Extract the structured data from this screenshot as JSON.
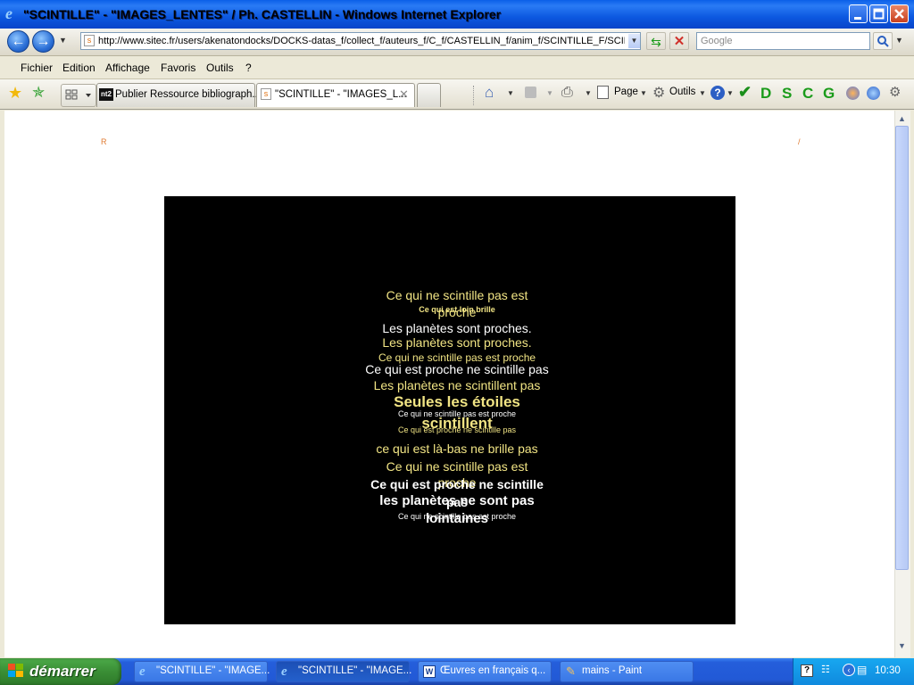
{
  "window": {
    "title": "\"SCINTILLE\" - \"IMAGES_LENTES\" / Ph. CASTELLIN - Windows Internet Explorer"
  },
  "address": {
    "url": "http://www.sitec.fr/users/akenatondocks/DOCKS-datas_f/collect_f/auteurs_f/C_f/CASTELLIN_f/anim_f/SCINTILLE_F/SCIN"
  },
  "search": {
    "placeholder": "Google"
  },
  "menu": [
    "Fichier",
    "Edition",
    "Affichage",
    "Favoris",
    "Outils",
    "?"
  ],
  "tabs": [
    {
      "label": "Publier Ressource bibliograph...",
      "icon": "nt2-icon"
    },
    {
      "label": "\"SCINTILLE\" - \"IMAGES_L...",
      "icon": "page-icon"
    }
  ],
  "commandbar": {
    "page_label": "Page",
    "tools_label": "Outils",
    "letter_icons": [
      "D",
      "S",
      "C",
      "G"
    ]
  },
  "page": {
    "left_mark": "R",
    "right_mark": "/"
  },
  "poem": [
    {
      "text": "Ce qui ne scintille pas est",
      "cls": "y",
      "size": 14,
      "weight": "normal"
    },
    {
      "text": "Ce qui est loin brille",
      "cls": "y",
      "size": 9,
      "weight": "bold"
    },
    {
      "text": "proche",
      "cls": "y",
      "size": 14,
      "weight": "normal"
    },
    {
      "text": "Les planètes sont proches.",
      "cls": "w",
      "size": 14,
      "weight": "normal"
    },
    {
      "text": "Les planètes sont proches.",
      "cls": "y",
      "size": 14,
      "weight": "normal"
    },
    {
      "text": "Ce qui ne scintille pas est proche",
      "cls": "y",
      "size": 12,
      "weight": "normal"
    },
    {
      "text": "Ce qui est proche ne scintille pas",
      "cls": "w",
      "size": 14,
      "weight": "normal"
    },
    {
      "text": "Les planètes ne scintillent pas",
      "cls": "y",
      "size": 14,
      "weight": "normal"
    },
    {
      "text": "Seules les étoiles",
      "cls": "y",
      "size": 17,
      "weight": "bold"
    },
    {
      "text": "Ce qui ne scintille pas est proche",
      "cls": "w",
      "size": 9,
      "weight": "normal"
    },
    {
      "text": "scintillent",
      "cls": "y",
      "size": 17,
      "weight": "bold"
    },
    {
      "text": "Ce qui est proche ne scintille pas",
      "cls": "y",
      "size": 9,
      "weight": "normal"
    },
    {
      "text": "ce qui est là-bas ne brille pas",
      "cls": "y",
      "size": 14,
      "weight": "normal"
    },
    {
      "text": "Ce qui ne scintille pas est",
      "cls": "y",
      "size": 14,
      "weight": "normal"
    },
    {
      "text": "proche",
      "cls": "y",
      "size": 14,
      "weight": "normal"
    },
    {
      "text": "Ce qui est proche ne scintille",
      "cls": "w",
      "size": 14,
      "weight": "bold"
    },
    {
      "text": "les planètes ne sont pas",
      "cls": "w",
      "size": 15,
      "weight": "bold"
    },
    {
      "text": "pas",
      "cls": "w",
      "size": 14,
      "weight": "bold"
    },
    {
      "text": "Ce qui ne scintille pas est proche",
      "cls": "w",
      "size": 9,
      "weight": "normal"
    },
    {
      "text": "lointaines",
      "cls": "w",
      "size": 15,
      "weight": "bold"
    }
  ],
  "taskbar": {
    "start_label": "démarrer",
    "tasks": [
      {
        "label": "\"SCINTILLE\" - \"IMAGE...",
        "icon": "ie-icon",
        "active": false
      },
      {
        "label": "\"SCINTILLE\" - \"IMAGE...",
        "icon": "ie-icon",
        "active": true
      },
      {
        "label": "Œuvres en français q...",
        "icon": "word-icon",
        "active": false
      },
      {
        "label": "mains - Paint",
        "icon": "paint-icon",
        "active": false
      }
    ],
    "clock": "10:30"
  }
}
